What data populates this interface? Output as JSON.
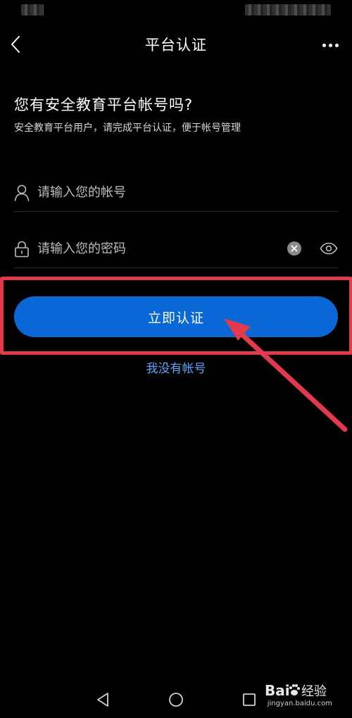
{
  "header": {
    "title": "平台认证"
  },
  "intro": {
    "heading": "您有安全教育平台帐号吗?",
    "subheading": "安全教育平台用户，请完成平台认证，便于帐号管理"
  },
  "form": {
    "account": {
      "placeholder": "请输入您的帐号",
      "value": "",
      "icon": "user-icon"
    },
    "password": {
      "placeholder": "请输入您的密码",
      "value": "",
      "icon": "lock-icon"
    },
    "submit_label": "立即认证",
    "no_account_label": "我没有帐号"
  },
  "colors": {
    "background": "#000000",
    "primary_button": "#0a67d6",
    "link": "#5aa7ff",
    "annotation": "#e2394f"
  },
  "watermark": {
    "text": "jingyan.baidu.com"
  }
}
